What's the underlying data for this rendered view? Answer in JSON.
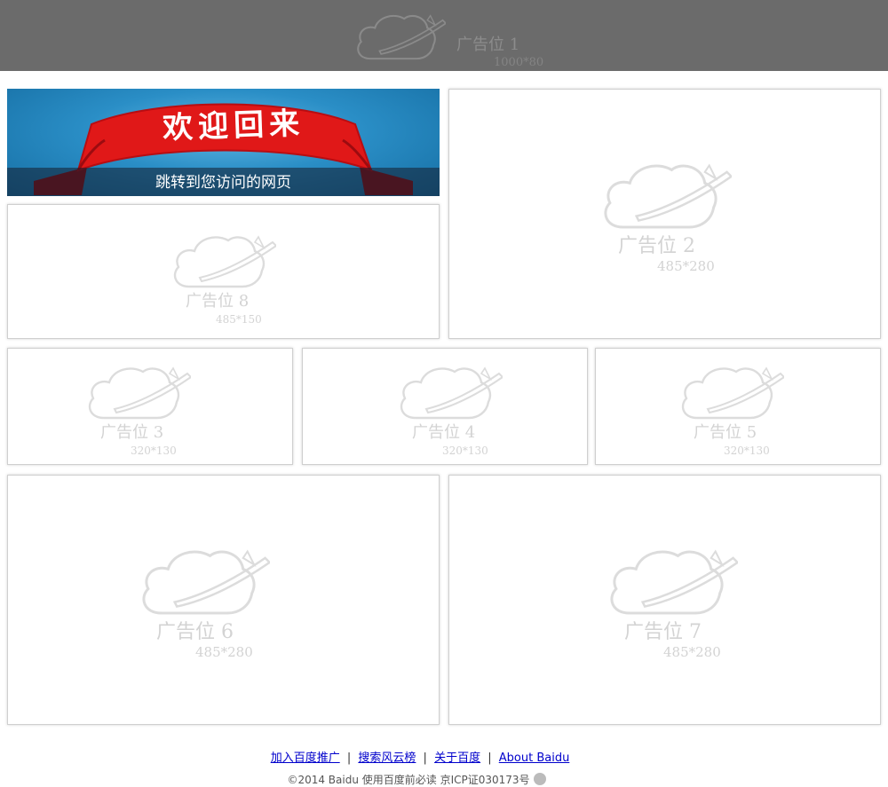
{
  "ad1": {
    "title": "广告位 1",
    "size": "1000*80"
  },
  "ad2": {
    "title": "广告位 2",
    "size": "485*280"
  },
  "ad3": {
    "title": "广告位 3",
    "size": "320*130"
  },
  "ad4": {
    "title": "广告位 4",
    "size": "320*130"
  },
  "ad5": {
    "title": "广告位 5",
    "size": "320*130"
  },
  "ad6": {
    "title": "广告位 6",
    "size": "485*280"
  },
  "ad7": {
    "title": "广告位 7",
    "size": "485*280"
  },
  "ad8": {
    "title": "广告位 8",
    "size": "485*150"
  },
  "welcome": {
    "banner": "欢迎回来",
    "caption": "跳转到您访问的网页"
  },
  "footer": {
    "links": [
      "加入百度推广",
      "搜索风云榜",
      "关于百度",
      "About Baidu"
    ],
    "separator": "|",
    "copyright": "©2014 Baidu 使用百度前必读 京ICP证030173号"
  },
  "colors": {
    "topbar": "#6b6b6b",
    "banner_red": "#e01818",
    "banner_blue": "#2a8ec6",
    "link": "#0000cc"
  }
}
